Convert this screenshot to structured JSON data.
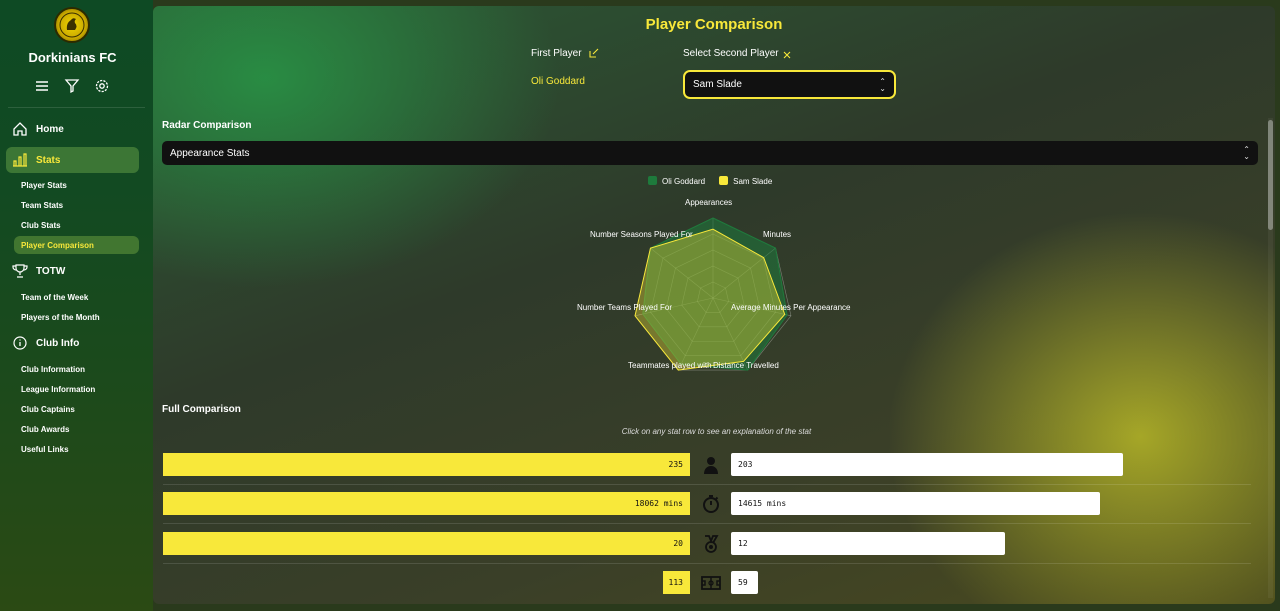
{
  "sidebar": {
    "club_name": "Dorkinians FC",
    "nav": [
      {
        "label": "Home",
        "icon": "home-icon"
      },
      {
        "label": "Stats",
        "icon": "bar-chart-icon",
        "active": true
      },
      {
        "label": "TOTW",
        "icon": "trophy-icon"
      },
      {
        "label": "Club Info",
        "icon": "info-icon"
      }
    ],
    "stats_sub": [
      "Player Stats",
      "Team Stats",
      "Club Stats",
      "Player Comparison"
    ],
    "totw_sub": [
      "Team of the Week",
      "Players of the Month"
    ],
    "club_sub": [
      "Club Information",
      "League Information",
      "Club Captains",
      "Club Awards",
      "Useful Links"
    ]
  },
  "main": {
    "title": "Player Comparison",
    "first_player_label": "First Player",
    "first_player_name": "Oli Goddard",
    "second_player_label": "Select Second Player",
    "second_player_value": "Sam Slade",
    "radar_section": "Radar Comparison",
    "radar_select": "Appearance Stats",
    "full_section": "Full Comparison",
    "hint": "Click on any stat row to see an explanation of the stat"
  },
  "colors": {
    "player1": "#1e7a3c",
    "player2": "#f8e83a",
    "accent": "#f8e83a"
  },
  "chart_data": {
    "type": "radar",
    "axes": [
      "Appearances",
      "Minutes",
      "Average Minutes Per Appearance",
      "Distance Travelled",
      "Teammates played with",
      "Number Teams Played For",
      "Number Seasons Played For"
    ],
    "series": [
      {
        "name": "Oli Goddard",
        "values": [
          100,
          100,
          95,
          100,
          92,
          90,
          100
        ]
      },
      {
        "name": "Sam Slade",
        "values": [
          86,
          81,
          92,
          88,
          100,
          100,
          100
        ]
      }
    ],
    "range": [
      0,
      100
    ]
  },
  "comparison": [
    {
      "left": "235",
      "right": "203",
      "left_frac": 1.0,
      "right_frac": 0.86,
      "icon": "person-icon"
    },
    {
      "left": "18062 mins",
      "right": "14615 mins",
      "left_frac": 1.0,
      "right_frac": 0.81,
      "icon": "stopwatch-icon"
    },
    {
      "left": "20",
      "right": "12",
      "left_frac": 1.0,
      "right_frac": 0.6,
      "icon": "medal-icon"
    },
    {
      "left": "113",
      "right": "59",
      "left_frac": 0.05,
      "right_frac": 0.05,
      "icon": "pitch-icon"
    }
  ]
}
